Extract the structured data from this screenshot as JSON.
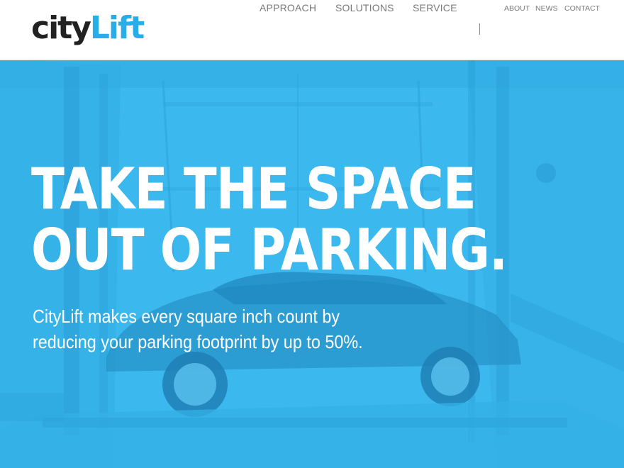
{
  "logo": {
    "part1": "city",
    "part2": "Lift"
  },
  "nav": {
    "main": [
      "APPROACH",
      "SOLUTIONS",
      "SERVICE"
    ],
    "secondary": [
      "ABOUT",
      "NEWS",
      "CONTACT"
    ]
  },
  "hero": {
    "headline_line1": "TAKE THE SPACE",
    "headline_line2": "OUT OF PARKING.",
    "sub_line1": "CityLift makes every square inch count by",
    "sub_line2": "reducing your parking footprint by up to 50%."
  },
  "colors": {
    "brand_blue": "#27aee8",
    "hero_overlay": "#3bb8ee",
    "logo_dark": "#222222",
    "nav_text": "#7a7a7a"
  },
  "icons": {
    "hero_background": "parked-car-photo"
  }
}
